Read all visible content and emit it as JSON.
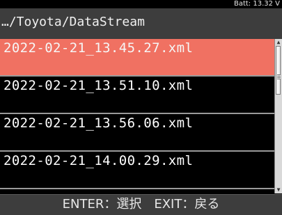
{
  "status": {
    "battery": "Batt: 13.32 V"
  },
  "header": {
    "path": "…/Toyota/DataStream"
  },
  "files": [
    {
      "name": "2022-02-21_13.45.27.xml",
      "selected": true
    },
    {
      "name": "2022-02-21_13.51.10.xml",
      "selected": false
    },
    {
      "name": "2022-02-21_13.56.06.xml",
      "selected": false
    },
    {
      "name": "2022-02-21_14.00.29.xml",
      "selected": false
    }
  ],
  "footer": {
    "hint": "ENTER：選択　EXIT：戻る"
  },
  "scrollbar": {
    "up_icon": "scroll-up-arrow",
    "down_icon": "scroll-down-arrow"
  },
  "colors": {
    "selection": "#f07162",
    "bar": "#3d3d3d",
    "background": "#000000"
  }
}
